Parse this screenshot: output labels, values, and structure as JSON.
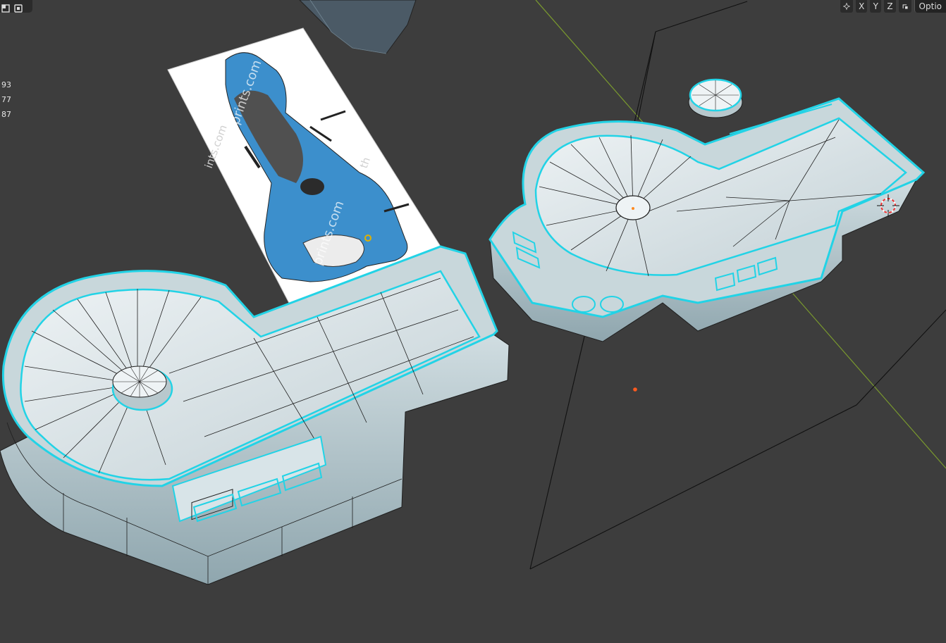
{
  "viewport": {
    "stats": [
      "93",
      "77",
      "87"
    ],
    "axis_toggles": [
      "X",
      "Y",
      "Z"
    ],
    "options_label": "Optio",
    "reference_image": {
      "watermark": [
        "prints.com",
        "prints.com",
        "ints.com",
        "th"
      ]
    },
    "icons": {
      "toolbar_left": [
        "viewport-shading-icon",
        "overlay-toggle-icon"
      ],
      "toolbar_right": [
        "mirror-gizmo-icon",
        "snap-options-icon"
      ],
      "scene": [
        "3d-cursor-icon",
        "origin-point-icon"
      ]
    },
    "colors": {
      "background": "#3d3d3d",
      "mesh_fill": "#c4d3d8",
      "mesh_wire": "#1f1f1f",
      "selection": "#22d3e6",
      "reference_blue": "#3c8fcc",
      "y_axis_line": "#7a9a2e",
      "origin_dot": "#ff5a1f"
    }
  }
}
